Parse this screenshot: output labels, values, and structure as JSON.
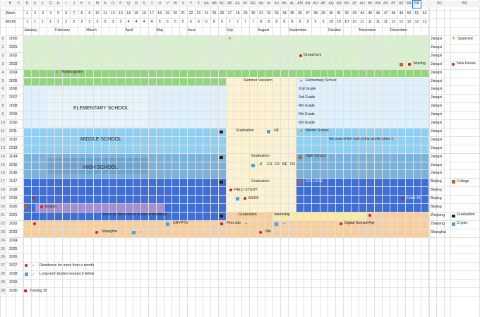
{
  "sheet": {
    "col_letters": [
      "B",
      "C",
      "D",
      "E",
      "F",
      "G",
      "H",
      "I",
      "J",
      "K",
      "L",
      "M",
      "N",
      "O",
      "P",
      "Q",
      "R",
      "S",
      "T",
      "U",
      "V",
      "W",
      "X",
      "Y",
      "Z",
      "AA",
      "AB",
      "AC",
      "AD",
      "AE",
      "AF",
      "AG",
      "AH",
      "AI",
      "AJ",
      "AK",
      "AL",
      "AM",
      "AN",
      "AO",
      "AP",
      "AQ",
      "AR",
      "AS",
      "AT",
      "AU",
      "AV",
      "AW",
      "AX",
      "AY",
      "AZ",
      "BA",
      "BB",
      "BC",
      "BD"
    ],
    "week_label": "Week",
    "month_label": "Month",
    "weeks": [
      "1",
      "2",
      "3",
      "4",
      "5",
      "6",
      "7",
      "8",
      "9",
      "10",
      "11",
      "12",
      "13",
      "14",
      "15",
      "16",
      "17",
      "18",
      "19",
      "20",
      "21",
      "22",
      "23",
      "24",
      "25",
      "26",
      "27",
      "28",
      "29",
      "30",
      "31",
      "32",
      "33",
      "34",
      "35",
      "36",
      "37",
      "38",
      "39",
      "40",
      "41",
      "42",
      "43",
      "44",
      "45",
      "46",
      "47",
      "48",
      "49",
      "50",
      "51",
      "52"
    ],
    "month_numbers": [
      "1",
      "1",
      "1",
      "1",
      "2",
      "2",
      "2",
      "2",
      "3",
      "3",
      "3",
      "3",
      "3",
      "4",
      "4",
      "4",
      "4",
      "5",
      "5",
      "5",
      "5",
      "6",
      "6",
      "6",
      "6",
      "6",
      "7",
      "7",
      "7",
      "7",
      "8",
      "8",
      "8",
      "8",
      "9",
      "9",
      "9",
      "9",
      "9",
      "10",
      "10",
      "10",
      "10",
      "11",
      "11",
      "11",
      "11",
      "12",
      "12",
      "12",
      "12",
      "12"
    ],
    "month_names": [
      "January",
      "February",
      "March",
      "April",
      "May",
      "June",
      "July",
      "August",
      "September",
      "October",
      "November",
      "December"
    ],
    "row_numbers": [
      "0",
      "1",
      "2",
      "3",
      "4",
      "5",
      "6",
      "7",
      "8",
      "9",
      "10",
      "11",
      "12",
      "13",
      "14",
      "15",
      "16",
      "17",
      "18",
      "19",
      "20",
      "21",
      "22",
      "23",
      "24",
      "25",
      "26",
      "27",
      "28",
      "29",
      "30"
    ],
    "years": [
      "2000",
      "2001",
      "2002",
      "2003",
      "2004",
      "2005",
      "2006",
      "2007",
      "2008",
      "2009",
      "2010",
      "2011",
      "2012",
      "2013",
      "2014",
      "2015",
      "2016",
      "2017",
      "2018",
      "2019",
      "2020",
      "2021",
      "2022",
      "2023",
      "2024",
      "2025",
      "2026",
      "2027",
      "2028",
      "2029",
      "2030"
    ],
    "locations": [
      "Jiangxi",
      "Jiangxi",
      "Jiangxi",
      "Jiangxi",
      "Jiangxi",
      "Jiangxi",
      "Jiangxi",
      "Jiangxi",
      "Jiangxi",
      "Jiangxi",
      "Jiangxi",
      "Jiangxi",
      "Jiangxi",
      "Jiangxi",
      "Jiangxi",
      "Jiangxi",
      "Jiangxi",
      "Beijing",
      "Beijing",
      "Beijing",
      "Beijing",
      "Zhejiang",
      "Zhejiang",
      "Shanghai"
    ]
  },
  "events": {
    "grandmas": "Grandma's",
    "moving": "Moving",
    "kindergarten": "Kindergarten",
    "summer_vacation": "Summer Vacation",
    "elementary_school_start": "Elementary School",
    "grade2": "2nd Grade",
    "grade3": "3rd Grade",
    "grade4": "4th Grade",
    "grade5": "5th Grade",
    "grade6": "6th Grade",
    "elementary_school_block": "ELEMENTARY SCHOOL",
    "graduation_2011": "Graduation",
    "hk": "HK",
    "middle_school_start": "Middle School",
    "middle_school_block": "MIDDLE SCHOOL",
    "world_end": "the year of the end of the world rumor :)",
    "graduation_2014": "Graduation",
    "high_school_start": "High School",
    "high_school_block": "HIGH SCHOOL",
    "trip_codes": [
      "JI",
      "CH",
      "FR",
      "BE",
      "DS"
    ],
    "graduation_2017": "Graduation",
    "college": "COLLEGE",
    "field_study": "FIELD STUDY",
    "meiri": "MEIRI",
    "covid": "Covid 19",
    "boston": "Boston",
    "bradbury": "Thesis on the science fiction of Bradbury",
    "graduation_2021": "Graduation",
    "internship": "Internship",
    "crypto": "CRYPTO",
    "first_job": "First Job",
    "digital_nomad": "Digital Nomad Anji",
    "shanghai": "Shanghai",
    "jilin": "Jilin"
  },
  "legend": {
    "spawned": "Spawned",
    "new_house": "New House",
    "college": "College",
    "graduation": "Graduation",
    "crypto": "Crypto",
    "residence": "Residence for more than a month",
    "research": "Long-term funded research fellow",
    "turning30": "Turning 30"
  },
  "arrow": "→",
  "colors": {
    "kindergarten": "#d9f0cf",
    "kindergarten_bar": "#93d57c",
    "elementary": "#def0fb",
    "middle": "#8fd0f2",
    "high": "#7cb1d9",
    "college": "#3f6fd6",
    "boston": "#a48fcf",
    "work": "#f6cfa0",
    "summer": "#fdf2cf"
  }
}
